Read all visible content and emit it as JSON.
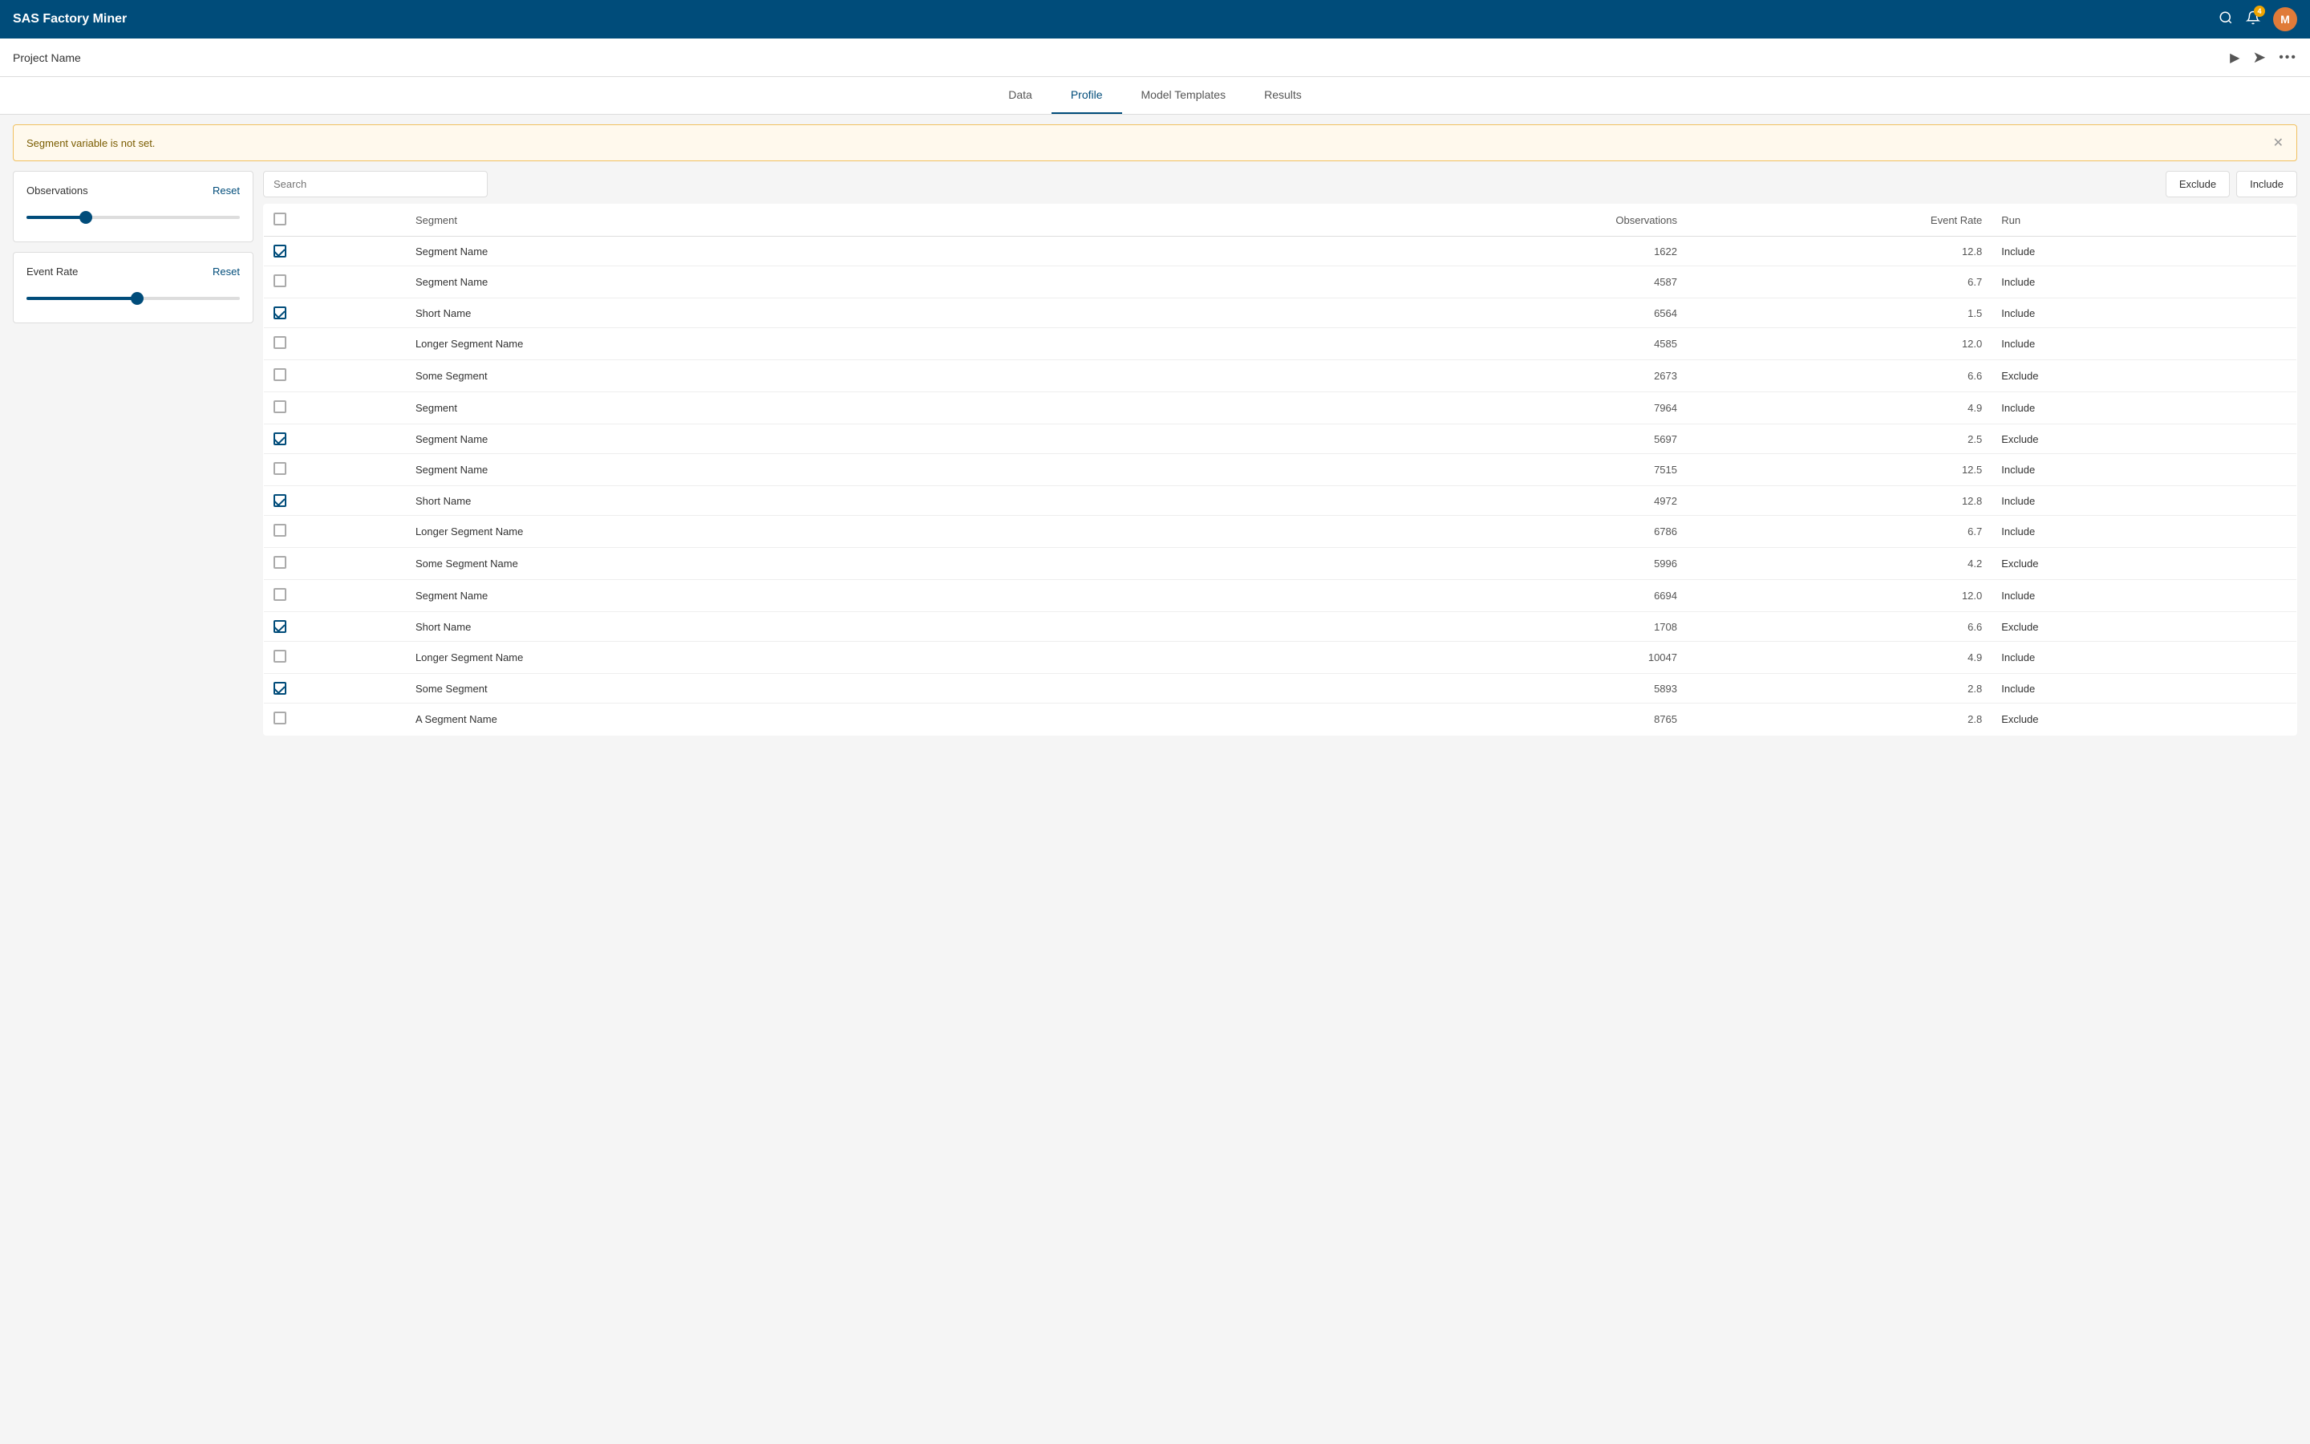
{
  "app": {
    "title": "SAS Factory Miner",
    "notification_count": "4",
    "avatar_initial": "M"
  },
  "project": {
    "name": "Project Name"
  },
  "project_actions": {
    "play": "▶",
    "share": "→",
    "more": "···"
  },
  "tabs": [
    {
      "id": "data",
      "label": "Data",
      "active": false
    },
    {
      "id": "profile",
      "label": "Profile",
      "active": true
    },
    {
      "id": "model-templates",
      "label": "Model Templates",
      "active": false
    },
    {
      "id": "results",
      "label": "Results",
      "active": false
    }
  ],
  "alert": {
    "message": "Segment variable is not set."
  },
  "filters": {
    "observations": {
      "title": "Observations",
      "reset": "Reset",
      "fill_pct": 28,
      "thumb_pct": 28
    },
    "event_rate": {
      "title": "Event Rate",
      "reset": "Reset",
      "fill_pct": 52,
      "thumb_pct": 52
    }
  },
  "search": {
    "placeholder": "Search"
  },
  "buttons": {
    "exclude": "Exclude",
    "include": "Include"
  },
  "table": {
    "columns": [
      {
        "id": "checkbox",
        "label": ""
      },
      {
        "id": "segment",
        "label": "Segment"
      },
      {
        "id": "observations",
        "label": "Observations"
      },
      {
        "id": "event_rate",
        "label": "Event Rate"
      },
      {
        "id": "run",
        "label": "Run"
      }
    ],
    "rows": [
      {
        "checked": true,
        "segment": "Segment Name",
        "observations": "1622",
        "event_rate": "12.8",
        "run": "Include"
      },
      {
        "checked": false,
        "segment": "Segment Name",
        "observations": "4587",
        "event_rate": "6.7",
        "run": "Include"
      },
      {
        "checked": true,
        "segment": "Short Name",
        "observations": "6564",
        "event_rate": "1.5",
        "run": "Include"
      },
      {
        "checked": false,
        "segment": "Longer Segment Name",
        "observations": "4585",
        "event_rate": "12.0",
        "run": "Include"
      },
      {
        "checked": false,
        "segment": "Some Segment",
        "observations": "2673",
        "event_rate": "6.6",
        "run": "Exclude"
      },
      {
        "checked": false,
        "segment": "Segment",
        "observations": "7964",
        "event_rate": "4.9",
        "run": "Include"
      },
      {
        "checked": true,
        "segment": "Segment Name",
        "observations": "5697",
        "event_rate": "2.5",
        "run": "Exclude"
      },
      {
        "checked": false,
        "segment": "Segment Name",
        "observations": "7515",
        "event_rate": "12.5",
        "run": "Include"
      },
      {
        "checked": true,
        "segment": "Short Name",
        "observations": "4972",
        "event_rate": "12.8",
        "run": "Include"
      },
      {
        "checked": false,
        "segment": "Longer Segment Name",
        "observations": "6786",
        "event_rate": "6.7",
        "run": "Include"
      },
      {
        "checked": false,
        "segment": "Some Segment Name",
        "observations": "5996",
        "event_rate": "4.2",
        "run": "Exclude"
      },
      {
        "checked": false,
        "segment": "Segment Name",
        "observations": "6694",
        "event_rate": "12.0",
        "run": "Include"
      },
      {
        "checked": true,
        "segment": "Short Name",
        "observations": "1708",
        "event_rate": "6.6",
        "run": "Exclude"
      },
      {
        "checked": false,
        "segment": "Longer Segment Name",
        "observations": "10047",
        "event_rate": "4.9",
        "run": "Include"
      },
      {
        "checked": true,
        "segment": "Some Segment",
        "observations": "5893",
        "event_rate": "2.8",
        "run": "Include"
      },
      {
        "checked": false,
        "segment": "A Segment Name",
        "observations": "8765",
        "event_rate": "2.8",
        "run": "Exclude"
      }
    ]
  }
}
